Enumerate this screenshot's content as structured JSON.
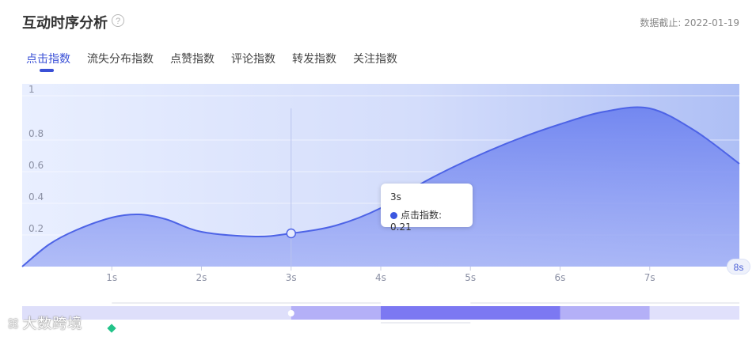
{
  "header": {
    "title": "互动时序分析",
    "help_icon_glyph": "?",
    "date_label": "数据截止: 2022-01-19"
  },
  "tabs": [
    {
      "label": "点击指数",
      "active": true
    },
    {
      "label": "流失分布指数",
      "active": false
    },
    {
      "label": "点赞指数",
      "active": false
    },
    {
      "label": "评论指数",
      "active": false
    },
    {
      "label": "转发指数",
      "active": false
    },
    {
      "label": "关注指数",
      "active": false
    }
  ],
  "chart_data": {
    "type": "area",
    "x_unit": "s",
    "x_ticks": [
      "1s",
      "2s",
      "3s",
      "4s",
      "5s",
      "6s",
      "7s"
    ],
    "y_ticks": [
      "1",
      "0.8",
      "0.6",
      "0.4",
      "0.2"
    ],
    "xlim": [
      0,
      8
    ],
    "ylim": [
      0,
      1
    ],
    "series": [
      {
        "name": "点击指数",
        "color": "#4d63e6",
        "points": [
          [
            0,
            0
          ],
          [
            0.3,
            0.14
          ],
          [
            0.6,
            0.23
          ],
          [
            1.0,
            0.31
          ],
          [
            1.3,
            0.33
          ],
          [
            1.6,
            0.3
          ],
          [
            2.0,
            0.22
          ],
          [
            2.6,
            0.19
          ],
          [
            3.0,
            0.21
          ],
          [
            3.5,
            0.26
          ],
          [
            4.0,
            0.37
          ],
          [
            4.5,
            0.54
          ],
          [
            5.0,
            0.68
          ],
          [
            5.5,
            0.8
          ],
          [
            6.0,
            0.9
          ],
          [
            6.5,
            0.98
          ],
          [
            7.0,
            1.0
          ],
          [
            7.5,
            0.86
          ],
          [
            8.0,
            0.65
          ]
        ]
      }
    ],
    "hover": {
      "x": 3,
      "x_label": "3s",
      "series_name": "点击指数",
      "value": 0.21
    },
    "end_label": "8s",
    "grid": true,
    "range_selector": {
      "segments": [
        {
          "from": 0,
          "to": 3,
          "color": "#dedffa"
        },
        {
          "from": 3,
          "to": 4,
          "color": "#b4b0f7"
        },
        {
          "from": 4,
          "to": 6,
          "color": "#7c78f2"
        },
        {
          "from": 6,
          "to": 7,
          "color": "#b4b0f7"
        },
        {
          "from": 7,
          "to": 8,
          "color": "#e0e0fb"
        }
      ]
    }
  },
  "tooltip": {
    "x_label": "3s",
    "series_label": "点击指数",
    "value_text": "0.21"
  },
  "watermark": {
    "icon_glyph": "ꕤ",
    "text": "大数跨境"
  }
}
